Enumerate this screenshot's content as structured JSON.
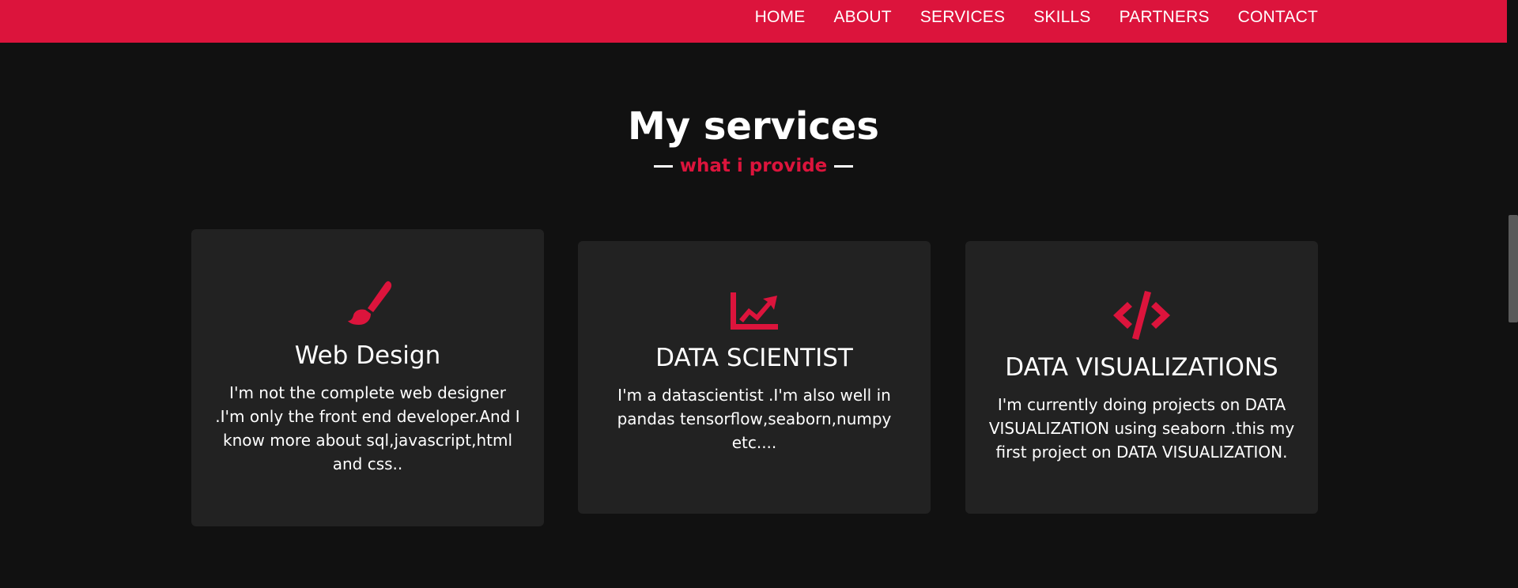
{
  "nav": {
    "items": [
      "HOME",
      "ABOUT",
      "SERVICES",
      "SKILLS",
      "PARTNERS",
      "CONTACT"
    ]
  },
  "section": {
    "title": "My services",
    "subtitle": "what i provide"
  },
  "cards": [
    {
      "icon": "paint-brush-icon",
      "title": "Web Design",
      "text": "I'm not the complete web designer .I'm only the front end developer.And I know more about sql,javascript,html and css.."
    },
    {
      "icon": "chart-line-icon",
      "title": "DATA SCIENTIST",
      "text": "I'm a datascientist .I'm also well in pandas tensorflow,seaborn,numpy etc...."
    },
    {
      "icon": "code-icon",
      "title": "DATA VISUALIZATIONS",
      "text": "I'm currently doing projects on DATA VISUALIZATION using seaborn .this my first project on DATA VISUALIZATION."
    }
  ],
  "colors": {
    "accent": "#dc143c",
    "background": "#111111",
    "card": "#222222",
    "text": "#ffffff"
  }
}
